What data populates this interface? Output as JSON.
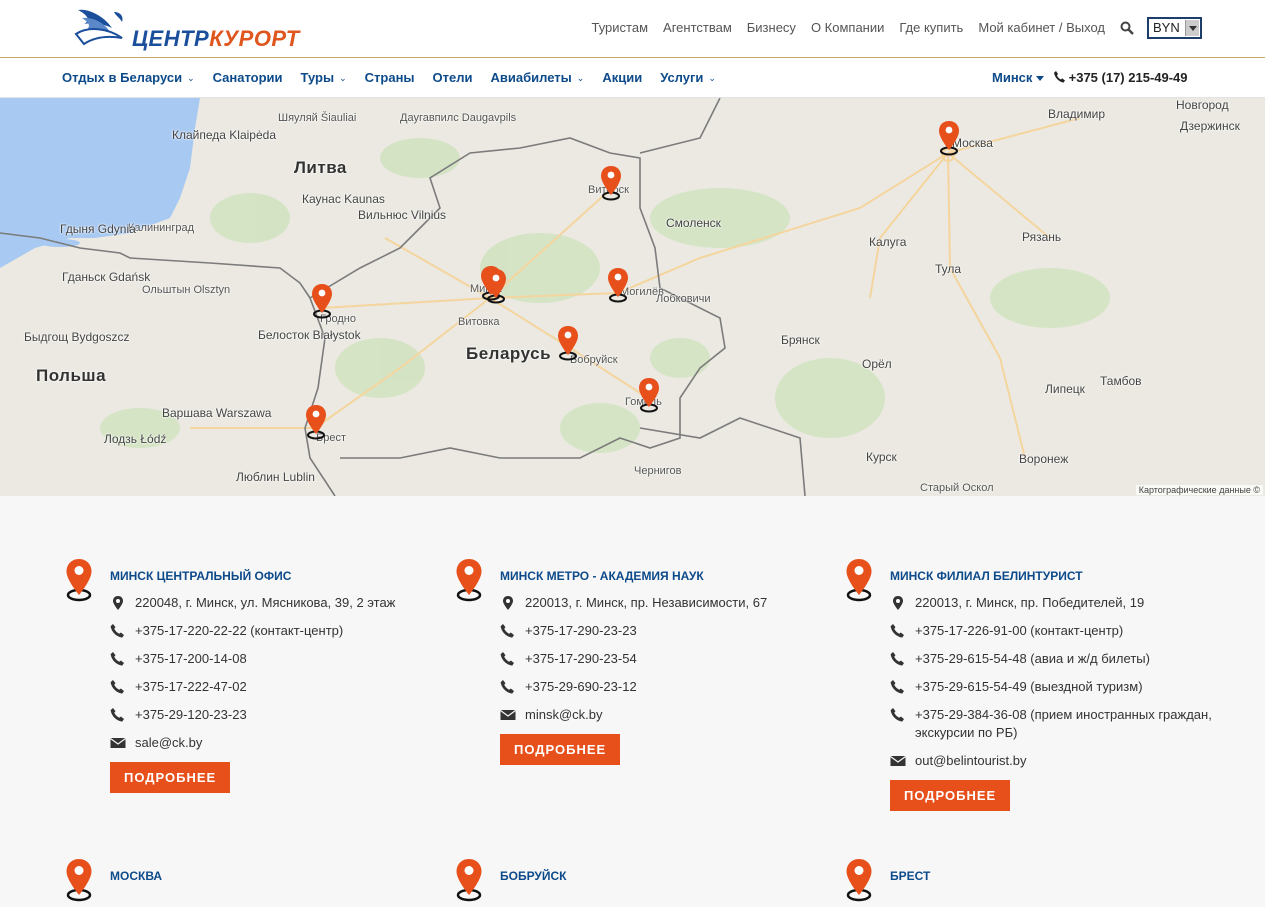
{
  "logo": {
    "text_part1": "ЦЕНТР",
    "text_part2": "КУРОРТ"
  },
  "top_nav": [
    "Туристам",
    "Агентствам",
    "Бизнесу",
    "О Компании",
    "Где купить",
    "Мой кабинет / Выход"
  ],
  "currency": {
    "selected": "BYN"
  },
  "main_nav": [
    {
      "label": "Отдых в Беларуси",
      "dropdown": true
    },
    {
      "label": "Санатории",
      "dropdown": false
    },
    {
      "label": "Туры",
      "dropdown": true
    },
    {
      "label": "Страны",
      "dropdown": false
    },
    {
      "label": "Отели",
      "dropdown": false
    },
    {
      "label": "Авиабилеты",
      "dropdown": true
    },
    {
      "label": "Акции",
      "dropdown": false
    },
    {
      "label": "Услуги",
      "dropdown": true
    }
  ],
  "city": "Минск",
  "phone": "+375 (17) 215-49-49",
  "map": {
    "credit": "Картографические данные ©",
    "countries": [
      "Литва",
      "Беларусь",
      "Польша"
    ],
    "cities": [
      "Клайпеда Klaipėda",
      "Шяуляй Šiauliai",
      "Даугавпилс Daugavpils",
      "Каунас Kaunas",
      "Вильнюс Vilnius",
      "Калининград",
      "Гдыня Gdynia",
      "Гданьск Gdańsk",
      "Ольштын Olsztyn",
      "Быдгощ Bydgoszcz",
      "Белосток Białystok",
      "Варшава Warszawa",
      "Лодзь Łódź",
      "Люблин Lublin",
      "Гродно",
      "Брест",
      "Минск",
      "Витовка",
      "Витебск",
      "Могилёв",
      "Бобруйск",
      "Гомель",
      "Лобковичи",
      "Смоленск",
      "Москва",
      "Новгород",
      "Владимир",
      "Дзержинск",
      "Калуга",
      "Рязань",
      "Тула",
      "Брянск",
      "Орёл",
      "Липецк",
      "Тамбов",
      "Курск",
      "Воронеж",
      "Старый Оскол",
      "Чернигов"
    ]
  },
  "offices": [
    {
      "title": "Минск Центральный офис",
      "address": "220048, г. Минск, ул. Мясникова, 39, 2 этаж",
      "phones": [
        "+375-17-220-22-22 (контакт-центр)",
        "+375-17-200-14-08",
        "+375-17-222-47-02",
        "+375-29-120-23-23"
      ],
      "email": "sale@ck.by",
      "button": "ПОДРОБНЕЕ"
    },
    {
      "title": "Минск метро - Академия наук",
      "address": "220013, г. Минск, пр. Независимости, 67",
      "phones": [
        "+375-17-290-23-23",
        "+375-17-290-23-54",
        "+375-29-690-23-12"
      ],
      "email": "minsk@ck.by",
      "button": "ПОДРОБНЕЕ"
    },
    {
      "title": "Минск Филиал Белинтурист",
      "address": "220013, г. Минск, пр. Победителей, 19",
      "phones": [
        "+375-17-226-91-00 (контакт-центр)",
        "+375-29-615-54-48 (авиа и ж/д билеты)",
        "+375-29-615-54-49 (выездной туризм)",
        "+375-29-384-36-08 (прием иностранных граждан, экскурсии по РБ)"
      ],
      "email": "out@belintourist.by",
      "button": "ПОДРОБНЕЕ"
    }
  ],
  "offices_row2": [
    "Москва",
    "Бобруйск",
    "Брест"
  ],
  "colors": {
    "brand_blue": "#0d4a8a",
    "accent_orange": "#e8501b",
    "logo_blue": "#1b4f9c"
  }
}
